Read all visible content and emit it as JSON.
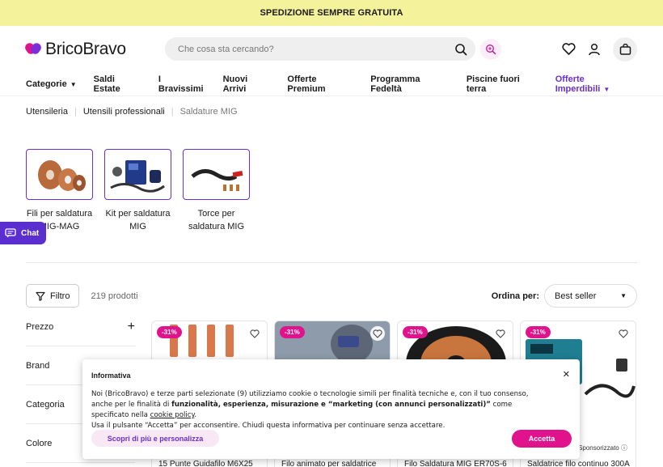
{
  "topbar": {
    "text": "SPEDIZIONE SEMPRE GRATUITA"
  },
  "header": {
    "logo_text": "BricoBravo",
    "search_placeholder": "Che cosa sta cercando?"
  },
  "nav": {
    "items": [
      "Categorie",
      "Saldi Estate",
      "I Bravissimi",
      "Nuovi Arrivi",
      "Offerte Premium",
      "Programma Fedeltà",
      "Piscine fuori terra",
      "Offerte Imperdibili"
    ]
  },
  "breadcrumb": [
    "Utensileria",
    "Utensili professionali",
    "Saldature MIG"
  ],
  "categories": [
    {
      "line1": "Fili per saldatura",
      "line2": "MIG-MAG"
    },
    {
      "line1": "Kit per saldatura",
      "line2": "MIG"
    },
    {
      "line1": "Torce per",
      "line2": "saldatura MIG"
    }
  ],
  "chat": {
    "label": "Chat"
  },
  "toolbar": {
    "filter_label": "Filtro",
    "count": "219 prodotti",
    "sort_label": "Ordina per:",
    "sort_value": "Best seller"
  },
  "facets": [
    "Prezzo",
    "Brand",
    "Categoria",
    "Colore"
  ],
  "products": [
    {
      "badge": "-31%",
      "title": "15 Punte Guidafilo M6X25"
    },
    {
      "badge": "-31%",
      "title": "Filo animato per saldatrice"
    },
    {
      "badge": "-31%",
      "title": "Filo Saldatura MIG ER70S-6"
    },
    {
      "badge": "-31%",
      "title": "Saldatrice filo continuo 300A",
      "sponsor": "Sponsorizzato"
    }
  ],
  "cookie": {
    "title": "Informativa",
    "text1": "Noi (BricoBravo) e terze parti selezionate (9) utilizziamo cookie o tecnologie simili per finalità tecniche e, con il tuo consenso, anche per le finalità di ",
    "text_bold": "funzionalità, esperienza, misurazione e “marketing (con annunci personalizzati)”",
    "text2": " come specificato nella ",
    "link": "cookie policy",
    "text3": ".",
    "line2": "Usa il pulsante “Accetta” per acconsentire. Chiudi questa informativa per continuare senza accettare.",
    "more_button": "Scopri di più e personalizza",
    "accept_button": "Accetta"
  },
  "colors": {
    "accent": "#e0138c",
    "purple": "#6a2fd2",
    "topbar": "#f4f29a"
  }
}
